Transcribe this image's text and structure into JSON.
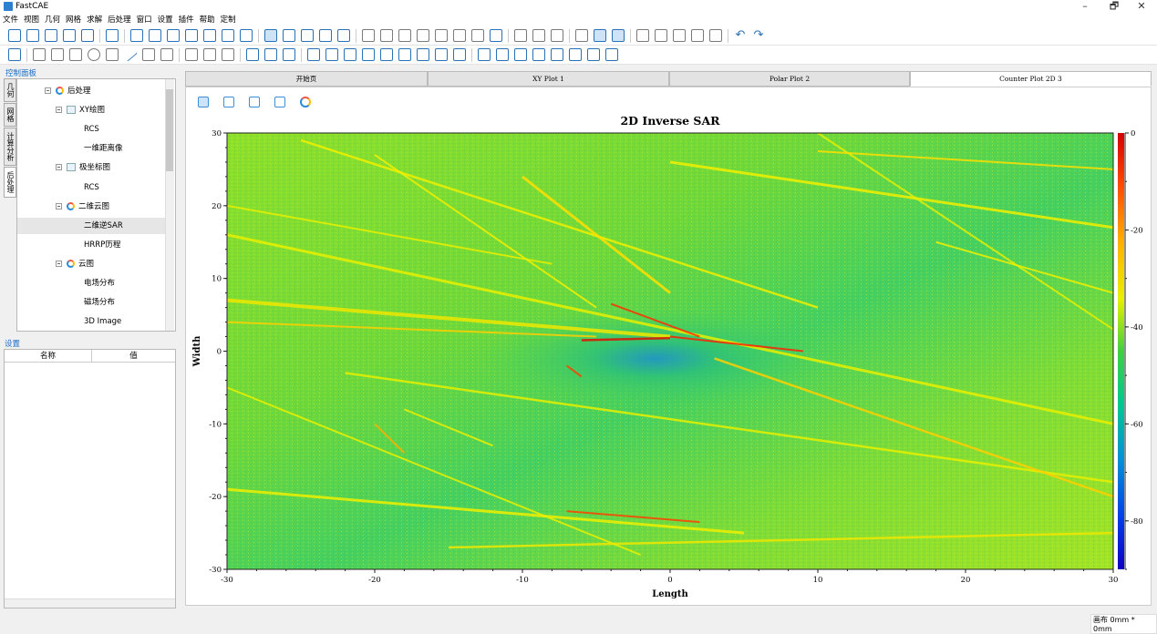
{
  "app": {
    "title": "FastCAE"
  },
  "window_controls": {
    "minimize": "–",
    "restore": "🗗",
    "close": "✕"
  },
  "menu": [
    "文件",
    "视图",
    "几何",
    "网格",
    "求解",
    "后处理",
    "窗口",
    "设置",
    "插件",
    "帮助",
    "定制"
  ],
  "left_panel": {
    "title": "控制面板",
    "side_tabs": [
      "几何",
      "网格",
      "计算分析",
      "后处理"
    ],
    "tree": [
      {
        "label": "后处理",
        "level": 0,
        "icon": "postprocess-icon",
        "expandable": true
      },
      {
        "label": "XY绘图",
        "level": 1,
        "icon": "xy-plot-icon",
        "expandable": true
      },
      {
        "label": "RCS",
        "level": 2
      },
      {
        "label": "一维距离像",
        "level": 2
      },
      {
        "label": "极坐标图",
        "level": 1,
        "icon": "polar-plot-icon",
        "expandable": true
      },
      {
        "label": "RCS",
        "level": 2
      },
      {
        "label": "二维云图",
        "level": 1,
        "icon": "contour-2d-icon",
        "expandable": true
      },
      {
        "label": "二维逆SAR",
        "level": 2,
        "selected": true
      },
      {
        "label": "HRRP历程",
        "level": 2
      },
      {
        "label": "云图",
        "level": 1,
        "icon": "contour-icon",
        "expandable": true
      },
      {
        "label": "电场分布",
        "level": 2
      },
      {
        "label": "磁场分布",
        "level": 2
      },
      {
        "label": "3D Image",
        "level": 2
      }
    ]
  },
  "settings": {
    "title": "设置",
    "columns": [
      "名称",
      "值"
    ]
  },
  "tabs": [
    {
      "label": "开始页",
      "active": false
    },
    {
      "label": "XY Plot 1",
      "active": false
    },
    {
      "label": "Polar Plot 2",
      "active": false
    },
    {
      "label": "Counter Plot 2D 3",
      "active": true
    }
  ],
  "chart_data": {
    "type": "heatmap",
    "title": "2D Inverse SAR",
    "xlabel": "Length",
    "ylabel": "Width",
    "xlim": [
      -30,
      30
    ],
    "ylim": [
      -30,
      30
    ],
    "xticks": [
      -30,
      -20,
      -10,
      0,
      10,
      20,
      30
    ],
    "yticks": [
      30,
      20,
      10,
      0,
      -10,
      -20,
      -30
    ],
    "colorbar": {
      "min": -90,
      "max": 0,
      "ticks": [
        0,
        -20,
        -40,
        -60,
        -80
      ],
      "colormap": "jet"
    }
  },
  "status_bar": {
    "canvas_size": "画布 0mm * 0mm"
  },
  "colors": {
    "accent": "#1a6fc4",
    "icon_blue": "#2a72b8"
  }
}
